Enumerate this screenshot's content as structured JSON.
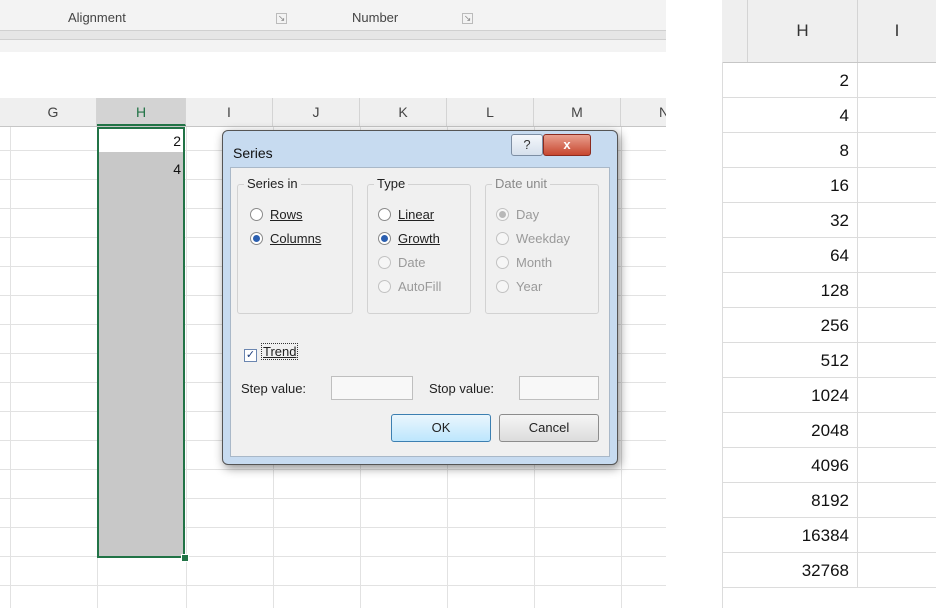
{
  "ribbon": {
    "groups": [
      {
        "label": "Alignment",
        "launcher": "launcher-icon"
      },
      {
        "label": "Number",
        "launcher": "launcher-icon"
      }
    ]
  },
  "left_sheet": {
    "columns": [
      "G",
      "H",
      "I",
      "J",
      "K",
      "L",
      "M",
      "N"
    ],
    "selected_column": "H",
    "cells": [
      {
        "col": "H",
        "row": 1,
        "value": "2"
      },
      {
        "col": "H",
        "row": 2,
        "value": "4"
      }
    ]
  },
  "dialog": {
    "title": "Series",
    "help_icon": "?",
    "close_icon": "x",
    "series_in": {
      "legend": "Series in",
      "options": [
        {
          "label": "Rows",
          "selected": false
        },
        {
          "label": "Columns",
          "selected": true
        }
      ]
    },
    "type": {
      "legend": "Type",
      "options": [
        {
          "label": "Linear",
          "selected": false,
          "enabled": true
        },
        {
          "label": "Growth",
          "selected": true,
          "enabled": true
        },
        {
          "label": "Date",
          "selected": false,
          "enabled": false
        },
        {
          "label": "AutoFill",
          "selected": false,
          "enabled": false
        }
      ]
    },
    "date_unit": {
      "legend": "Date unit",
      "options": [
        {
          "label": "Day",
          "selected": true,
          "enabled": false
        },
        {
          "label": "Weekday",
          "selected": false,
          "enabled": false
        },
        {
          "label": "Month",
          "selected": false,
          "enabled": false
        },
        {
          "label": "Year",
          "selected": false,
          "enabled": false
        }
      ]
    },
    "trend": {
      "label": "Trend",
      "checked": true
    },
    "step_value": {
      "label": "Step value:",
      "value": ""
    },
    "stop_value": {
      "label": "Stop value:",
      "value": ""
    },
    "ok_label": "OK",
    "cancel_label": "Cancel"
  },
  "right_sheet": {
    "columns": [
      "H",
      "I"
    ],
    "values": [
      "2",
      "4",
      "8",
      "16",
      "32",
      "64",
      "128",
      "256",
      "512",
      "1024",
      "2048",
      "4096",
      "8192",
      "16384",
      "32768"
    ]
  },
  "colors": {
    "selection_border": "#217346",
    "selection_fill": "#c8c8c8",
    "dialog_frame": "#c7dbf0",
    "close_button": "#c7472f"
  }
}
